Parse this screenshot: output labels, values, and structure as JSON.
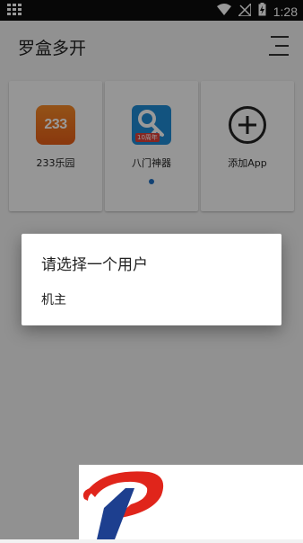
{
  "status_bar": {
    "time": "1:28"
  },
  "app_bar": {
    "title": "罗盒多开"
  },
  "apps": [
    {
      "label": "233乐园",
      "icon_text": "233",
      "icon": "233-park-icon"
    },
    {
      "label": "八门神器",
      "icon_badge": "10周年",
      "icon": "bamen-icon",
      "has_dot": true
    },
    {
      "label": "添加App",
      "icon": "add-circle-icon"
    }
  ],
  "dialog": {
    "title": "请选择一个用户",
    "options": [
      "机主"
    ]
  },
  "colors": {
    "accent_dot": "#1f6fc2",
    "icon_233": "#f07a22",
    "icon_bamen": "#1e8ad4",
    "banner_red": "#e0251b",
    "banner_blue": "#1d3f8f"
  }
}
